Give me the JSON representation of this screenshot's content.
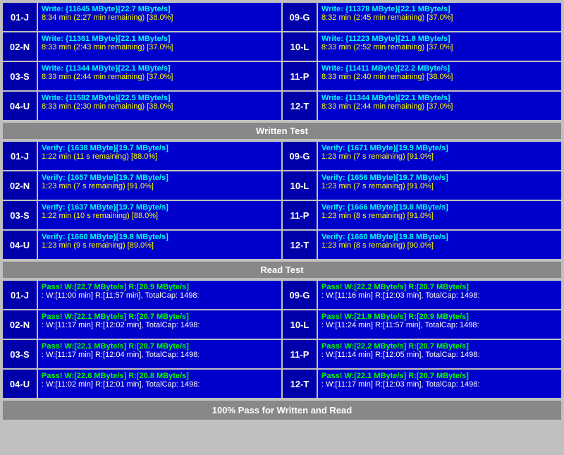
{
  "sections": {
    "write_test_label": "Written Test",
    "read_test_label": "Read Test",
    "pass_label": "100% Pass for Written and Read"
  },
  "write_rows": [
    {
      "left_id": "01-J",
      "left_line1": "Write: {11645 MByte}[22.7 MByte/s]",
      "left_line2": "8:34 min (2:27 min remaining)  [38.0%]",
      "right_id": "09-G",
      "right_line1": "Write: {11378 MByte}[22.1 MByte/s]",
      "right_line2": "8:32 min (2:45 min remaining)  [37.0%]"
    },
    {
      "left_id": "02-N",
      "left_line1": "Write: {11361 MByte}[22.1 MByte/s]",
      "left_line2": "8:33 min (2:43 min remaining)  [37.0%]",
      "right_id": "10-L",
      "right_line1": "Write: {11223 MByte}[21.8 MByte/s]",
      "right_line2": "8:33 min (2:52 min remaining)  [37.0%]"
    },
    {
      "left_id": "03-S",
      "left_line1": "Write: {11344 MByte}[22.1 MByte/s]",
      "left_line2": "8:33 min (2:44 min remaining)  [37.0%]",
      "right_id": "11-P",
      "right_line1": "Write: {11411 MByte}[22.2 MByte/s]",
      "right_line2": "8:33 min (2:40 min remaining)  [38.0%]"
    },
    {
      "left_id": "04-U",
      "left_line1": "Write: {11582 MByte}[22.5 MByte/s]",
      "left_line2": "8:33 min (2:30 min remaining)  [38.0%]",
      "right_id": "12-T",
      "right_line1": "Write: {11344 MByte}[22.1 MByte/s]",
      "right_line2": "8:33 min (2:44 min remaining)  [37.0%]"
    }
  ],
  "verify_rows": [
    {
      "left_id": "01-J",
      "left_line1": "Verify: {1638 MByte}[19.7 MByte/s]",
      "left_line2": "1:22 min (11 s remaining)   [88.0%]",
      "right_id": "09-G",
      "right_line1": "Verify: {1671 MByte}[19.9 MByte/s]",
      "right_line2": "1:23 min (7 s remaining)   [91.0%]"
    },
    {
      "left_id": "02-N",
      "left_line1": "Verify: {1657 MByte}[19.7 MByte/s]",
      "left_line2": "1:23 min (7 s remaining)   [91.0%]",
      "right_id": "10-L",
      "right_line1": "Verify: {1656 MByte}[19.7 MByte/s]",
      "right_line2": "1:23 min (7 s remaining)   [91.0%]"
    },
    {
      "left_id": "03-S",
      "left_line1": "Verify: {1637 MByte}[19.7 MByte/s]",
      "left_line2": "1:22 min (10 s remaining)   [88.0%]",
      "right_id": "11-P",
      "right_line1": "Verify: {1666 MByte}[19.8 MByte/s]",
      "right_line2": "1:23 min (8 s remaining)   [91.0%]"
    },
    {
      "left_id": "04-U",
      "left_line1": "Verify: {1660 MByte}[19.8 MByte/s]",
      "left_line2": "1:23 min (9 s remaining)   [89.0%]",
      "right_id": "12-T",
      "right_line1": "Verify: {1660 MByte}[19.8 MByte/s]",
      "right_line2": "1:23 min (8 s remaining)   [90.0%]"
    }
  ],
  "pass_rows": [
    {
      "left_id": "01-J",
      "left_line1": "Pass! W:[22.7 MByte/s] R:[20.9 MByte/s]",
      "left_line2": ": W:[11:00 min] R:[11:57 min], TotalCap: 1498:",
      "right_id": "09-G",
      "right_line1": "Pass! W:[22.2 MByte/s] R:[20.7 MByte/s]",
      "right_line2": ": W:[11:16 min] R:[12:03 min], TotalCap: 1498:"
    },
    {
      "left_id": "02-N",
      "left_line1": "Pass! W:[22.1 MByte/s] R:[20.7 MByte/s]",
      "left_line2": ": W:[11:17 min] R:[12:02 min], TotalCap: 1498:",
      "right_id": "10-L",
      "right_line1": "Pass! W:[21.9 MByte/s] R:[20.9 MByte/s]",
      "right_line2": ": W:[11:24 min] R:[11:57 min], TotalCap: 1498:"
    },
    {
      "left_id": "03-S",
      "left_line1": "Pass! W:[22.1 MByte/s] R:[20.7 MByte/s]",
      "left_line2": ": W:[11:17 min] R:[12:04 min], TotalCap: 1498:",
      "right_id": "11-P",
      "right_line1": "Pass! W:[22.2 MByte/s] R:[20.7 MByte/s]",
      "right_line2": ": W:[11:14 min] R:[12:05 min], TotalCap: 1498:"
    },
    {
      "left_id": "04-U",
      "left_line1": "Pass! W:[22.6 MByte/s] R:[20.8 MByte/s]",
      "left_line2": ": W:[11:02 min] R:[12:01 min], TotalCap: 1498:",
      "right_id": "12-T",
      "right_line1": "Pass! W:[22.1 MByte/s] R:[20.7 MByte/s]",
      "right_line2": ": W:[11:17 min] R:[12:03 min], TotalCap: 1498:"
    }
  ]
}
